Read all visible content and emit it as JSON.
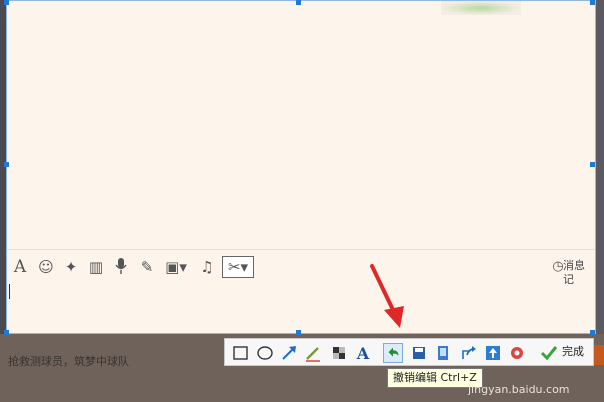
{
  "compose": {
    "history_label": "消息记"
  },
  "screenshot_toolbar": {
    "finish_label": "完成",
    "tooltip": "撤销编辑 Ctrl+Z"
  },
  "background": {
    "hint_text": "抢救测球员，筑梦中球队",
    "watermark": "jingyan.baidu.com"
  },
  "colors": {
    "selection_border": "#1e7ad8",
    "capture_bg": "#fdf5ec",
    "arrow": "#e02828",
    "finish_check": "#3aa63a"
  },
  "icons": {
    "compose": [
      "font-icon",
      "emoji-icon",
      "magic-icon",
      "video-icon",
      "microphone-icon",
      "edit-icon",
      "image-icon",
      "music-icon",
      "scissors-icon",
      "clock-icon"
    ],
    "screenshot": [
      "rectangle-icon",
      "ellipse-icon",
      "arrow-icon",
      "pen-icon",
      "mosaic-icon",
      "text-icon",
      "undo-icon",
      "save-icon",
      "pin-icon",
      "share-icon",
      "upload-icon",
      "settings-icon",
      "check-icon"
    ]
  }
}
